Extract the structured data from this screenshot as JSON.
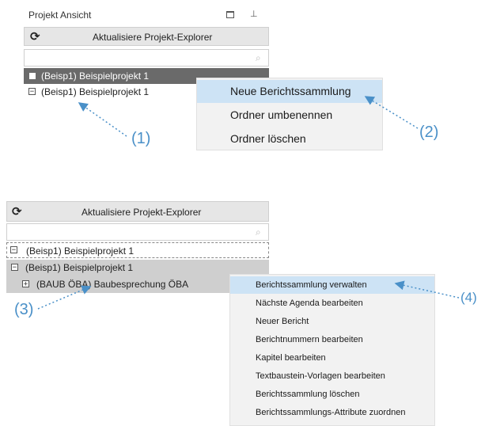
{
  "panel1": {
    "title": "Projekt Ansicht",
    "refresh_label": "Aktualisiere Projekt-Explorer",
    "tree": [
      "(Beisp1) Beispielprojekt 1",
      "(Beisp1) Beispielprojekt 1"
    ],
    "menu": [
      "Neue Berichtssammlung",
      "Ordner umbenennen",
      "Ordner löschen"
    ]
  },
  "panel2": {
    "refresh_label": "Aktualisiere Projekt-Explorer",
    "tree": [
      "(Beisp1) Beispielprojekt 1",
      "(Beisp1) Beispielprojekt 1",
      "(BAUB ÖBA) Baubesprechung ÖBA"
    ],
    "menu": [
      "Berichtssammlung verwalten",
      "Nächste Agenda bearbeiten",
      "Neuer Bericht",
      "Berichtnummern bearbeiten",
      "Kapitel bearbeiten",
      "Textbaustein-Vorlagen bearbeiten",
      "Berichtssammlung löschen",
      "Berichtssammlungs-Attribute zuordnen"
    ]
  },
  "callouts": [
    "(1)",
    "(2)",
    "(3)",
    "(4)"
  ],
  "icons": {
    "refresh": "refresh-icon",
    "search": "search-icon",
    "restore": "window-restore-icon",
    "pin": "pin-icon"
  },
  "colors": {
    "highlight": "#cde3f5",
    "callout": "#4a90c8",
    "selected_node": "#6a6a6a",
    "grey_node": "#cfcfcf"
  }
}
